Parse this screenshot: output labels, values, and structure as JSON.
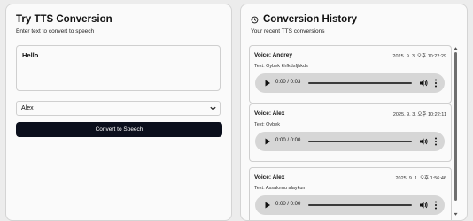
{
  "tts": {
    "title": "Try TTS Conversion",
    "subtitle": "Enter text to convert to speech",
    "text_value": "Hello",
    "voice_selected": "Alex",
    "convert_label": "Convert to Speech"
  },
  "history": {
    "title": "Conversion History",
    "subtitle": "Your recent TTS conversions",
    "items": [
      {
        "voice": "Voice: Andrey",
        "date": "2025. 9. 3. 오후 10:22:29",
        "text": "Text: Oybek khfkdsfjbkds",
        "time": "0:00 / 0:03"
      },
      {
        "voice": "Voice: Alex",
        "date": "2025. 9. 3. 오후 10:22:11",
        "text": "Text: Oybek",
        "time": "0:00 / 0:00"
      },
      {
        "voice": "Voice: Alex",
        "date": "2025. 9. 1. 오후 1:56:46",
        "text": "Text: Assalomu alaykum",
        "time": "0:00 / 0:00"
      }
    ]
  },
  "icons": {
    "history": "history-icon",
    "chevron": "chevron-down-icon",
    "play": "play-icon",
    "volume": "volume-icon",
    "more": "more-vertical-icon"
  },
  "colors": {
    "button_bg": "#0b0f1c",
    "player_bg": "#d6d6d6",
    "page_bg": "#ececec"
  }
}
